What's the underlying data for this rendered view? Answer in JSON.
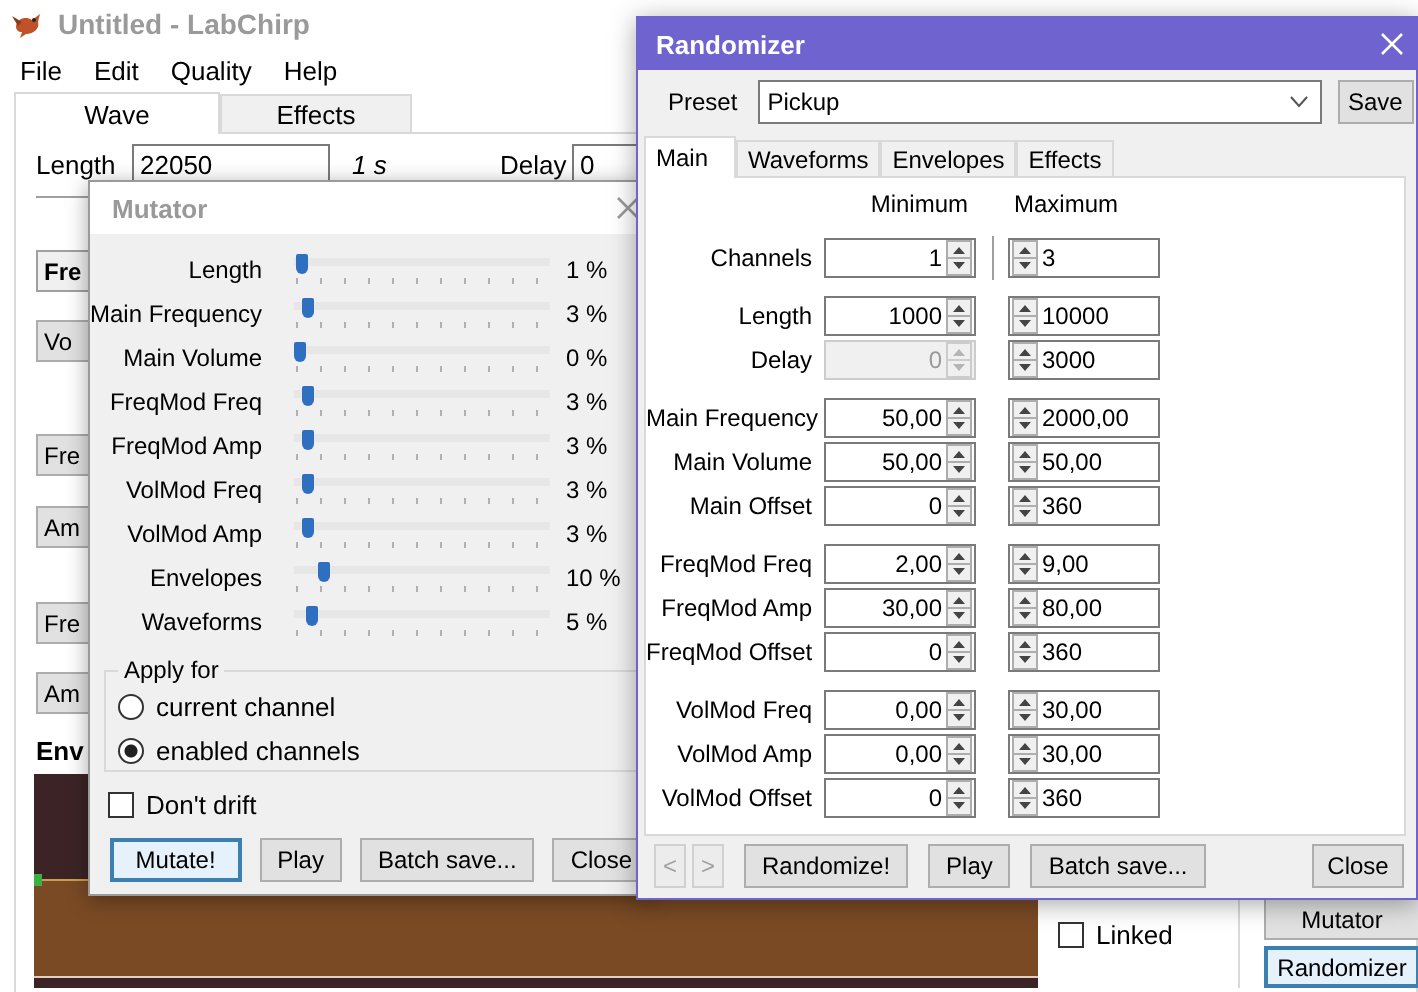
{
  "main_window": {
    "title": "Untitled - LabChirp",
    "menu": [
      "File",
      "Edit",
      "Quality",
      "Help"
    ],
    "tabs": [
      {
        "label": "Wave",
        "selected": true
      },
      {
        "label": "Effects",
        "selected": false
      }
    ],
    "length": {
      "label": "Length",
      "value": "22050",
      "duration": "1 s"
    },
    "delay": {
      "label": "Delay",
      "value": "0"
    },
    "section_buttons": [
      {
        "label": "Fre",
        "kind": "header"
      },
      {
        "label": "Vo",
        "kind": "button"
      },
      {
        "label": "Fre",
        "kind": "button"
      },
      {
        "label": "Am",
        "kind": "button"
      },
      {
        "label": "Fre",
        "kind": "button"
      },
      {
        "label": "Am",
        "kind": "button"
      }
    ],
    "envelope_label": "Env",
    "linked": {
      "label": "Linked",
      "checked": false
    },
    "buttons": [
      {
        "label": "Mutator",
        "focused": false
      },
      {
        "label": "Randomizer",
        "focused": true
      }
    ]
  },
  "mutator": {
    "title": "Mutator",
    "sliders": [
      {
        "label": "Length",
        "level": 0.01,
        "reading": "1 %"
      },
      {
        "label": "Main Frequency",
        "level": 0.03,
        "reading": "3 %"
      },
      {
        "label": "Main Volume",
        "level": 0,
        "reading": "0 %"
      },
      {
        "label": "FreqMod Freq",
        "level": 0.03,
        "reading": "3 %"
      },
      {
        "label": "FreqMod Amp",
        "level": 0.03,
        "reading": "3 %"
      },
      {
        "label": "VolMod Freq",
        "level": 0.03,
        "reading": "3 %"
      },
      {
        "label": "VolMod Amp",
        "level": 0.03,
        "reading": "3 %"
      },
      {
        "label": "Envelopes",
        "level": 0.1,
        "reading": "10 %"
      },
      {
        "label": "Waveforms",
        "level": 0.05,
        "reading": "5 %"
      }
    ],
    "apply_for": {
      "title": "Apply for",
      "options": [
        {
          "label": "current channel",
          "selected": false
        },
        {
          "label": "enabled channels",
          "selected": true
        }
      ]
    },
    "dont_drift": {
      "label": "Don't drift",
      "checked": false
    },
    "buttons": [
      {
        "label": "Mutate!",
        "focused": true
      },
      {
        "label": "Play",
        "focused": false
      },
      {
        "label": "Batch save...",
        "focused": false
      },
      {
        "label": "Close",
        "focused": false
      }
    ]
  },
  "randomizer": {
    "title": "Randomizer",
    "preset": {
      "label": "Preset",
      "value": "Pickup"
    },
    "save": "Save",
    "tabs": [
      {
        "label": "Main",
        "selected": true
      },
      {
        "label": "Waveforms",
        "selected": false
      },
      {
        "label": "Envelopes",
        "selected": false
      },
      {
        "label": "Effects",
        "selected": false
      }
    ],
    "columns": [
      "Minimum",
      "Maximum"
    ],
    "groups": [
      [
        {
          "label": "Channels",
          "min": "1",
          "max": "3",
          "disabled": false
        }
      ],
      [
        {
          "label": "Length",
          "min": "1000",
          "max": "10000",
          "disabled": false
        },
        {
          "label": "Delay",
          "min": "0",
          "max": "3000",
          "disabled": true
        }
      ],
      [
        {
          "label": "Main Frequency",
          "min": "50,00",
          "max": "2000,00",
          "disabled": false
        },
        {
          "label": "Main Volume",
          "min": "50,00",
          "max": "50,00",
          "disabled": false
        },
        {
          "label": "Main Offset",
          "min": "0",
          "max": "360",
          "disabled": false
        }
      ],
      [
        {
          "label": "FreqMod Freq",
          "min": "2,00",
          "max": "9,00",
          "disabled": false
        },
        {
          "label": "FreqMod Amp",
          "min": "30,00",
          "max": "80,00",
          "disabled": false
        },
        {
          "label": "FreqMod Offset",
          "min": "0",
          "max": "360",
          "disabled": false
        }
      ],
      [
        {
          "label": "VolMod Freq",
          "min": "0,00",
          "max": "30,00",
          "disabled": false
        },
        {
          "label": "VolMod Amp",
          "min": "0,00",
          "max": "30,00",
          "disabled": false
        },
        {
          "label": "VolMod Offset",
          "min": "0",
          "max": "360",
          "disabled": false
        }
      ]
    ],
    "nav": [
      {
        "label": "<",
        "disabled": true
      },
      {
        "label": ">",
        "disabled": true
      }
    ],
    "buttons": [
      "Randomize!",
      "Play",
      "Batch save..."
    ],
    "close": "Close"
  }
}
